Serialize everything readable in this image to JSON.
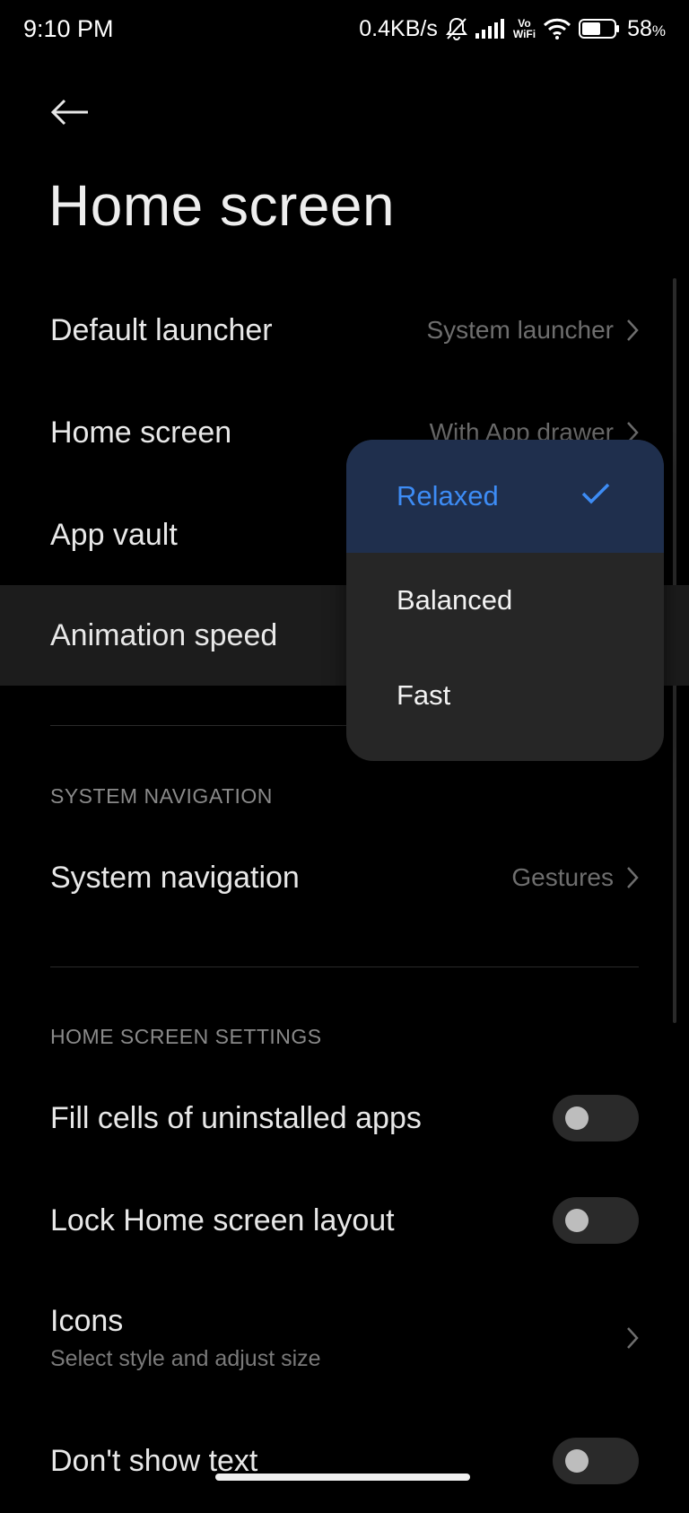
{
  "status_bar": {
    "time": "9:10 PM",
    "speed": "0.4KB/s",
    "vowifi_top": "Vo",
    "vowifi_bottom": "WiFi",
    "battery": "58",
    "battery_unit": "%"
  },
  "header": {
    "title": "Home screen"
  },
  "rows": {
    "default_launcher": {
      "label": "Default launcher",
      "value": "System launcher"
    },
    "home_screen": {
      "label": "Home screen",
      "value": "With App drawer"
    },
    "app_vault": {
      "label": "App vault"
    },
    "animation_speed": {
      "label": "Animation speed"
    }
  },
  "system_navigation_section": {
    "header": "SYSTEM NAVIGATION",
    "label": "System navigation",
    "value": "Gestures"
  },
  "home_settings_section": {
    "header": "HOME SCREEN SETTINGS",
    "fill_cells": {
      "label": "Fill cells of uninstalled apps",
      "on": false
    },
    "lock_layout": {
      "label": "Lock Home screen layout",
      "on": false
    },
    "icons": {
      "label": "Icons",
      "sub": "Select style and adjust size"
    },
    "dont_show_text": {
      "label": "Don't show text",
      "on": false
    }
  },
  "popup": {
    "options": [
      {
        "label": "Relaxed",
        "selected": true
      },
      {
        "label": "Balanced",
        "selected": false
      },
      {
        "label": "Fast",
        "selected": false
      }
    ]
  },
  "colors": {
    "accent": "#3d8cf5",
    "background": "#000000",
    "popup": "#262626",
    "selected_bg": "#1f2f4d"
  }
}
